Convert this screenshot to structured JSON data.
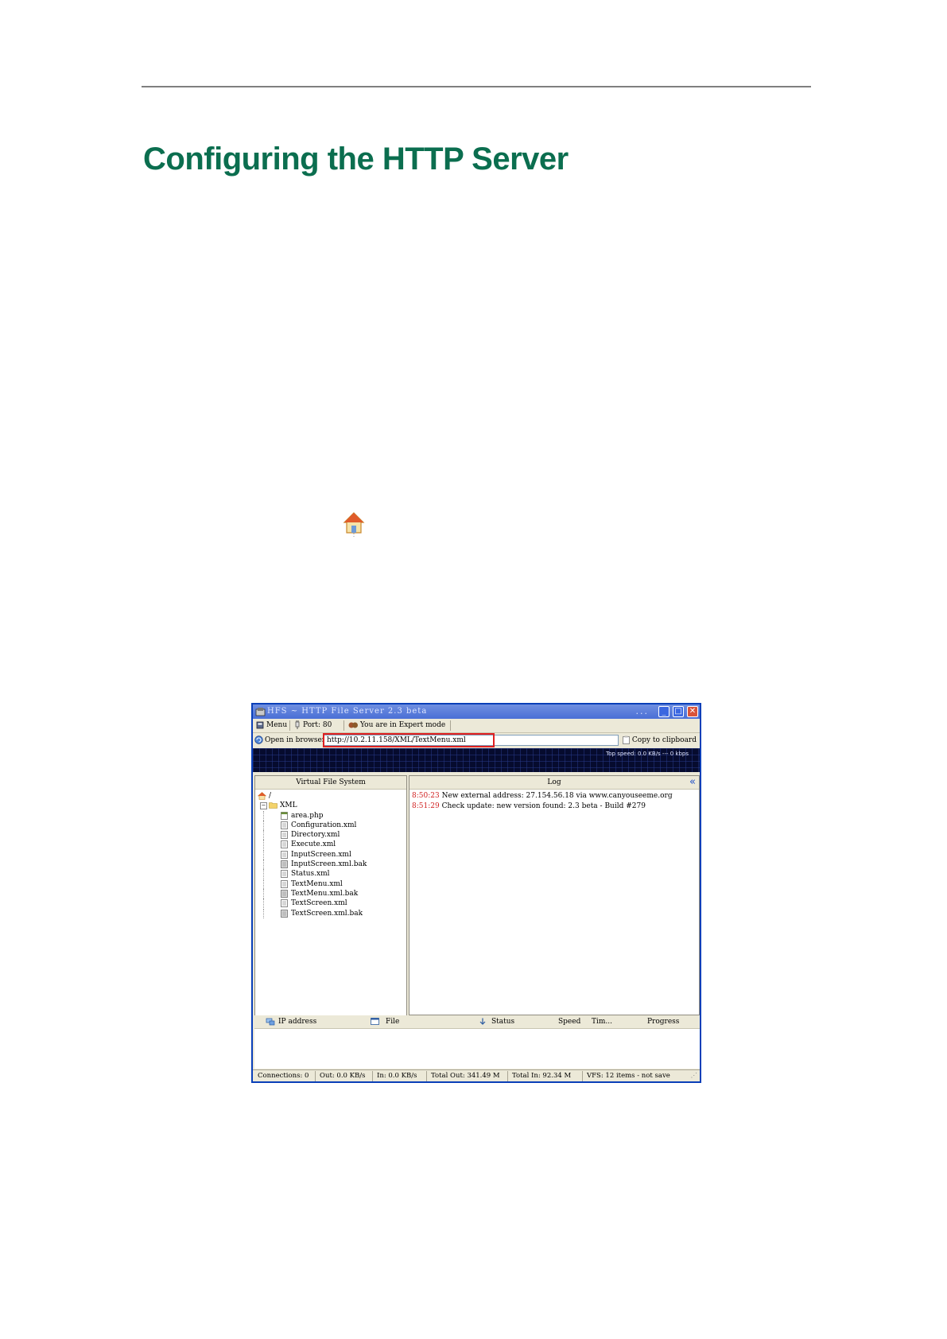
{
  "page": {
    "title": "Configuring the HTTP Server"
  },
  "window": {
    "title": "HFS ~ HTTP File Server 2.3 beta",
    "title_dots": "...",
    "toolbar": {
      "menu": "Menu",
      "port": "Port: 80",
      "mode": "You are in Expert mode"
    },
    "urlbar": {
      "open_in_browser": "Open in browser",
      "url": "http://10.2.11.158/XML/TextMenu.xml",
      "copy_to_clipboard": "Copy to clipboard"
    },
    "graph": {
      "top_speed": "Top speed: 0.0 KB/s  ---  0 kbps"
    },
    "vfs": {
      "header": "Virtual File System",
      "root": "/",
      "folder": "XML",
      "files": [
        "area.php",
        "Configuration.xml",
        "Directory.xml",
        "Execute.xml",
        "InputScreen.xml",
        "InputScreen.xml.bak",
        "Status.xml",
        "TextMenu.xml",
        "TextMenu.xml.bak",
        "TextScreen.xml",
        "TextScreen.xml.bak"
      ]
    },
    "log": {
      "header": "Log",
      "entries": [
        {
          "time": "8:50:23",
          "text": "New external address: 27.154.56.18 via www.canyouseeme.org"
        },
        {
          "time": "8:51:29",
          "text": "Check update: new version found: 2.3 beta - Build #279"
        }
      ]
    },
    "connections": {
      "columns": {
        "ip_address": "IP address",
        "file": "File",
        "status": "Status",
        "speed": "Speed",
        "time": "Tim...",
        "progress": "Progress"
      }
    },
    "statusbar": {
      "connections": "Connections: 0",
      "out": "Out: 0.0 KB/s",
      "in": "In: 0.0 KB/s",
      "total_out": "Total Out: 341.49 M",
      "total_in": "Total In: 92.34 M",
      "vfs": "VFS: 12 items - not save"
    }
  }
}
